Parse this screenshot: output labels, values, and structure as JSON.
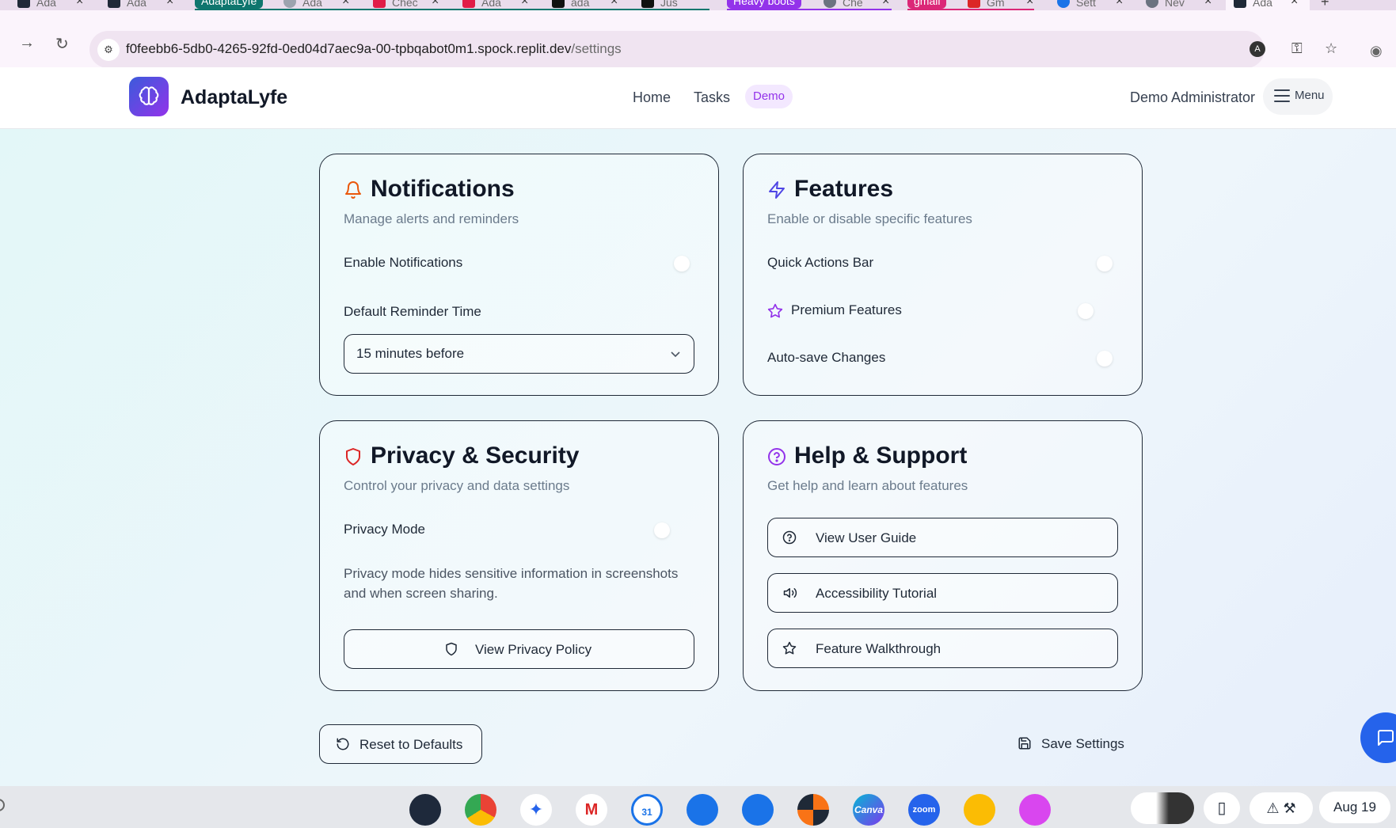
{
  "browser": {
    "tabs": [
      {
        "title": "Ada",
        "color": "#1f2937"
      },
      {
        "title": "Ada",
        "color": "#1f2937"
      },
      {
        "title": "Ada",
        "color": "#9ca3af"
      },
      {
        "title": "Chec",
        "color": "#e11d48"
      },
      {
        "title": "Ada",
        "color": "#e11d48"
      },
      {
        "title": "ada",
        "color": "#111111"
      },
      {
        "title": "Jus",
        "color": "#111111"
      },
      {
        "title": "Che",
        "color": "#6b7280"
      },
      {
        "title": "Gm",
        "color": "#dc2626"
      },
      {
        "title": "Sett",
        "color": "#1a73e8"
      },
      {
        "title": "Nev",
        "color": "#6b7280"
      },
      {
        "title": "Ada",
        "color": "#1f2937"
      }
    ],
    "groups": [
      {
        "label": "AdaptaLyfe",
        "color": "#0f766e"
      },
      {
        "label": "Heavy boots",
        "color": "#9333ea"
      },
      {
        "label": "gmail",
        "color": "#db2777"
      }
    ],
    "close_glyph": "×",
    "new_tab_glyph": "+",
    "url_host": "f0feebb6-5db0-4265-92fd-0ed04d7aec9a-00-tpbqabot0m1.spock.replit.dev",
    "url_path": "/settings",
    "profile_initial": "A"
  },
  "header": {
    "brand": "AdaptaLyfe",
    "nav": {
      "home": "Home",
      "tasks": "Tasks"
    },
    "demo_badge": "Demo",
    "user_name": "Demo Administrator",
    "menu_label": "Menu"
  },
  "cards": {
    "notifications": {
      "title": "Notifications",
      "subtitle": "Manage alerts and reminders",
      "enable_label": "Enable Notifications",
      "enable_on": false,
      "reminder_label": "Default Reminder Time",
      "reminder_value": "15 minutes before",
      "icon_color": "#ea580c"
    },
    "features": {
      "title": "Features",
      "subtitle": "Enable or disable specific features",
      "quick_actions_label": "Quick Actions Bar",
      "premium_label": "Premium Features",
      "autosave_label": "Auto-save Changes",
      "icon_color": "#4f46e5",
      "premium_icon_color": "#9333ea"
    },
    "privacy": {
      "title": "Privacy & Security",
      "subtitle": "Control your privacy and data settings",
      "privacy_mode_label": "Privacy Mode",
      "note": "Privacy mode hides sensitive information in screenshots and when screen sharing.",
      "policy_button": "View Privacy Policy",
      "icon_color": "#dc2626"
    },
    "help": {
      "title": "Help & Support",
      "subtitle": "Get help and learn about features",
      "user_guide": "View User Guide",
      "accessibility": "Accessibility Tutorial",
      "walkthrough": "Feature Walkthrough",
      "icon_color": "#9333ea"
    }
  },
  "actions": {
    "reset": "Reset to Defaults",
    "save": "Save Settings"
  },
  "shelf": {
    "apps": [
      {
        "name": "app-launcher",
        "color": "#1e293b",
        "label": ""
      },
      {
        "name": "chrome",
        "color": "#34a853",
        "label": ""
      },
      {
        "name": "gemini",
        "color": "#ffffff",
        "label": ""
      },
      {
        "name": "gmail",
        "color": "#ffffff",
        "label": "M"
      },
      {
        "name": "calendar",
        "color": "#1a73e8",
        "label": "31"
      },
      {
        "name": "files",
        "color": "#1a73e8",
        "label": ""
      },
      {
        "name": "messages",
        "color": "#1a73e8",
        "label": ""
      },
      {
        "name": "game",
        "color": "#1f2937",
        "label": ""
      },
      {
        "name": "canva",
        "color": "#7c3aed",
        "label": "Canva"
      },
      {
        "name": "zoom",
        "color": "#2563eb",
        "label": "zoom"
      },
      {
        "name": "keep",
        "color": "#fbbc04",
        "label": ""
      },
      {
        "name": "notes",
        "color": "#d946ef",
        "label": ""
      }
    ],
    "date": "Aug 19"
  }
}
